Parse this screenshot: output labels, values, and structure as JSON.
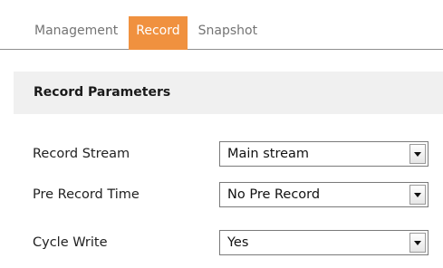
{
  "tabs": [
    {
      "label": "Management",
      "active": false
    },
    {
      "label": "Record",
      "active": true
    },
    {
      "label": "Snapshot",
      "active": false
    }
  ],
  "section": {
    "title": "Record Parameters"
  },
  "fields": {
    "record_stream": {
      "label": "Record Stream",
      "value": "Main stream"
    },
    "pre_record_time": {
      "label": "Pre Record Time",
      "value": "No Pre Record"
    },
    "cycle_write": {
      "label": "Cycle Write",
      "value": "Yes"
    }
  },
  "icons": {
    "dropdown": "chevron-down-icon"
  },
  "colors": {
    "active_tab_bg": "#f0913f",
    "active_tab_text": "#ffffff",
    "inactive_tab_text": "#747474",
    "section_bg": "#f0f0f0"
  }
}
